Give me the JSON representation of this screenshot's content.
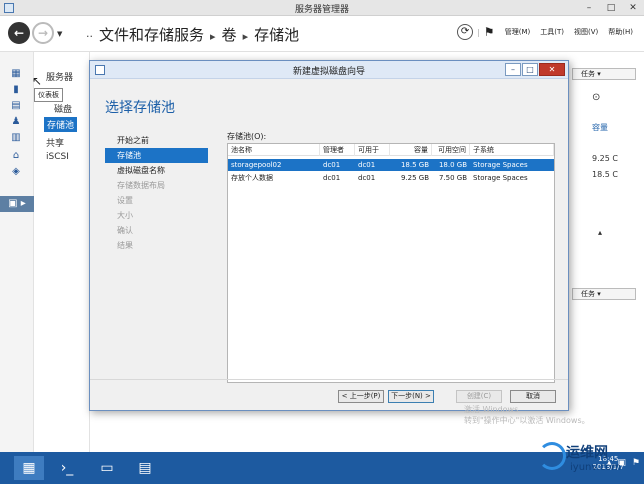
{
  "window": {
    "title": "服务器管理器",
    "min": "–",
    "max": "□",
    "close": "✕"
  },
  "nav": {
    "back_glyph": "←",
    "forward_glyph": "→",
    "dropdown_glyph": "▼",
    "breadcrumb": [
      "文件和存储服务",
      "卷",
      "存储池"
    ],
    "breadcrumb_prefix": "··",
    "separator": "▸",
    "menus": [
      "管理(M)",
      "工具(T)",
      "视图(V)",
      "帮助(H)"
    ]
  },
  "sidebar_tooltip": "仪表板",
  "left_nav": {
    "header": "服务器",
    "items": [
      "磁盘",
      "存储池",
      "共享",
      "iSCSI"
    ],
    "selected": "存储池"
  },
  "right_panel": {
    "task_label_1": "任务",
    "task_label_2": "任务",
    "capacity_label": "容量",
    "value_1": "9.25 C",
    "value_2": "18.5 C"
  },
  "wizard": {
    "title": "新建虚拟磁盘向导",
    "heading": "选择存储池",
    "steps": [
      {
        "label": "开始之前",
        "state": "normal"
      },
      {
        "label": "存储池",
        "state": "selected"
      },
      {
        "label": "虚拟磁盘名称",
        "state": "normal"
      },
      {
        "label": "存储数据布局",
        "state": "disabled"
      },
      {
        "label": "设置",
        "state": "disabled"
      },
      {
        "label": "大小",
        "state": "disabled"
      },
      {
        "label": "确认",
        "state": "disabled"
      },
      {
        "label": "结果",
        "state": "disabled"
      }
    ],
    "pool_label": "存储池(O):",
    "columns": [
      "池名称",
      "管理者",
      "可用于",
      "容量",
      "可用空间",
      "子系统"
    ],
    "rows": [
      [
        "storagepool02",
        "dc01",
        "dc01",
        "18.5 GB",
        "18.0 GB",
        "Storage Spaces"
      ],
      [
        "存放个人数据",
        "dc01",
        "dc01",
        "9.25 GB",
        "7.50 GB",
        "Storage Spaces"
      ]
    ],
    "selected_row": 0,
    "buttons": {
      "prev": "< 上一步(P)",
      "next": "下一步(N) >",
      "create": "创建(C)",
      "cancel": "取消"
    }
  },
  "watermark": {
    "line1": "激活 Windows",
    "line2": "转到\"操作中心\"以激活 Windows。"
  },
  "taskbar": {
    "time": "18:45",
    "date": "2013/1/7"
  },
  "logo": {
    "name": "运维网",
    "url": "iyunv.com"
  }
}
